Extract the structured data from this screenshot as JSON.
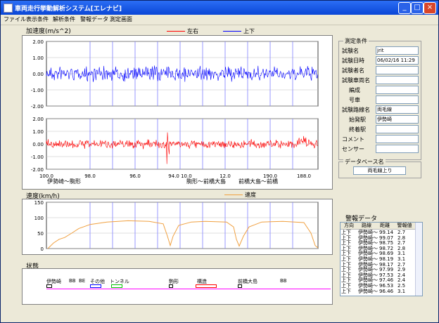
{
  "window": {
    "title": "車両走行挙動解析システム[エレナビ]",
    "buttons": [
      "_",
      "□",
      "×"
    ]
  },
  "menu": [
    "ファイル",
    "表示条件",
    "解析条件",
    "警報データ",
    "測定画面"
  ],
  "accel": {
    "title": "加速度(m/s^2)",
    "legend": [
      "左右",
      "上下"
    ],
    "upper_yticks": [
      "2.00",
      "1.00",
      "0.00",
      "-1.00",
      "-2.00"
    ],
    "lower_yticks": [
      "2.00",
      "1.00",
      "0.00",
      "-1.00",
      "-2.00"
    ],
    "km_ticks": [
      "100.0",
      "98.0",
      "96.0",
      "94.0 10.0",
      "12.0",
      "190.0",
      "188.0"
    ],
    "sections": [
      "伊勢崎～駒形",
      "駒形～前橋大島",
      "前橋大島～前橋"
    ]
  },
  "speed": {
    "title": "速度(km/h)",
    "legend": "速度",
    "yticks": [
      "150",
      "100",
      "50",
      "0"
    ]
  },
  "status": {
    "title": "状態",
    "items": [
      "伊勢崎",
      "BB",
      "BE",
      "その他",
      "トンネル",
      "駒形",
      "構造",
      "前橋大島",
      "BB"
    ]
  },
  "conditions": {
    "title": "測定条件",
    "fields": [
      {
        "label": "試験名",
        "value": "jrit"
      },
      {
        "label": "試験日時",
        "value": "06/02/16 11:29"
      },
      {
        "label": "試験者名",
        "value": ""
      },
      {
        "label": "試験車両名",
        "value": ""
      },
      {
        "label": "編成",
        "value": ""
      },
      {
        "label": "号車",
        "value": ""
      },
      {
        "label": "試験路線名",
        "value": "両毛線"
      },
      {
        "label": "始発駅",
        "value": "伊勢崎"
      },
      {
        "label": "終着駅",
        "value": ""
      },
      {
        "label": "コメント",
        "value": ""
      },
      {
        "label": "センサー",
        "value": ""
      }
    ]
  },
  "database": {
    "title": "データベース名",
    "value": "両毛線上り"
  },
  "alarm": {
    "title": "警報データ",
    "headers": [
      "方向",
      "路線",
      "距離",
      "警報値"
    ],
    "rows": [
      [
        "上下",
        "伊勢崎～",
        "99.14",
        "2.7"
      ],
      [
        "上下",
        "伊勢崎～",
        "99.07",
        "2.8"
      ],
      [
        "上下",
        "伊勢崎～",
        "98.75",
        "2.7"
      ],
      [
        "上下",
        "伊勢崎～",
        "98.72",
        "2.8"
      ],
      [
        "上下",
        "伊勢崎～",
        "98.69",
        "3.1"
      ],
      [
        "上下",
        "伊勢崎～",
        "98.19",
        "3.1"
      ],
      [
        "上下",
        "伊勢崎～",
        "98.17",
        "2.7"
      ],
      [
        "上下",
        "伊勢崎～",
        "97.99",
        "2.9"
      ],
      [
        "上下",
        "伊勢崎～",
        "97.53",
        "2.4"
      ],
      [
        "上下",
        "伊勢崎～",
        "97.46",
        "2.4"
      ],
      [
        "上下",
        "伊勢崎～",
        "96.53",
        "2.5"
      ],
      [
        "上下",
        "伊勢崎～",
        "96.46",
        "3.1"
      ]
    ]
  },
  "colors": {
    "lateral": "#ff0000",
    "vertical": "#0000ff",
    "speed": "#f0a040",
    "grid_v": "#8080ff",
    "grid_h": "#c0c0c0"
  }
}
